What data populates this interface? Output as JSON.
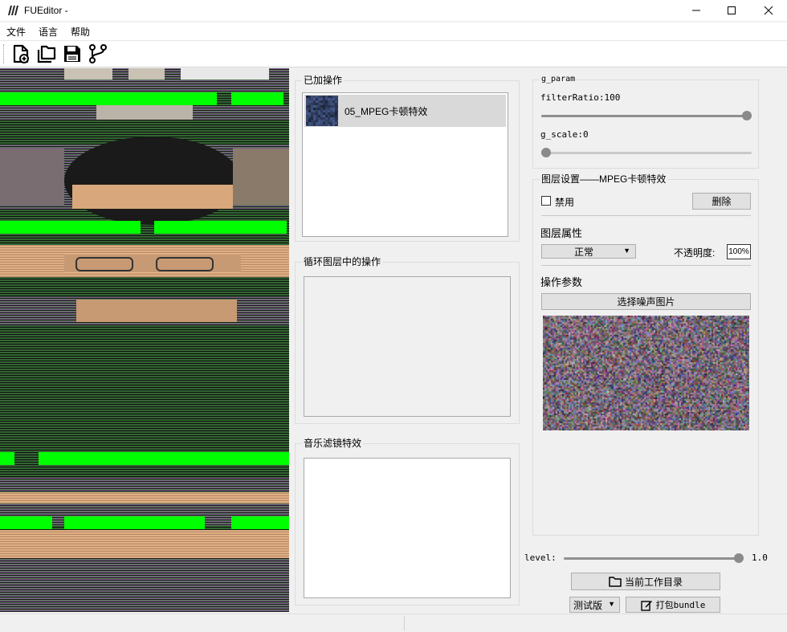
{
  "window": {
    "title": "FUEditor -",
    "controls": {
      "minimize": "—",
      "maximize": "☐",
      "close": "✕"
    }
  },
  "menu": [
    {
      "label": "文件"
    },
    {
      "label": "语言"
    },
    {
      "label": "帮助"
    }
  ],
  "toolbar": {
    "icons": [
      "new-file-icon",
      "open-files-icon",
      "save-icon",
      "branch-icon"
    ]
  },
  "added_ops": {
    "title": "已加操作",
    "items": [
      {
        "label": "05_MPEG卡顿特效"
      }
    ]
  },
  "loop_layer_ops": {
    "title": "循环图层中的操作"
  },
  "music_filter": {
    "title": "音乐滤镜特效"
  },
  "g_param": {
    "title": "g_param",
    "filter_ratio": {
      "label": "filterRatio:100",
      "value": 100,
      "max": 100
    },
    "g_scale": {
      "label": "g_scale:0",
      "value": 0,
      "max": 100
    }
  },
  "layer_settings": {
    "title": "图层设置——MPEG卡顿特效",
    "disable_label": "禁用",
    "disable_checked": false,
    "delete_label": "删除",
    "props_title": "图层属性",
    "blend_mode": "正常",
    "opacity_label": "不透明度:",
    "opacity_value": "100%",
    "op_params_title": "操作参数",
    "select_noise_label": "选择噪声图片"
  },
  "level": {
    "label": "level:",
    "value": 1.0,
    "value_text": "1.0"
  },
  "bottom": {
    "workdir_label": "当前工作目录",
    "version_label": "测试版",
    "bundle_label": "打包bundle"
  }
}
